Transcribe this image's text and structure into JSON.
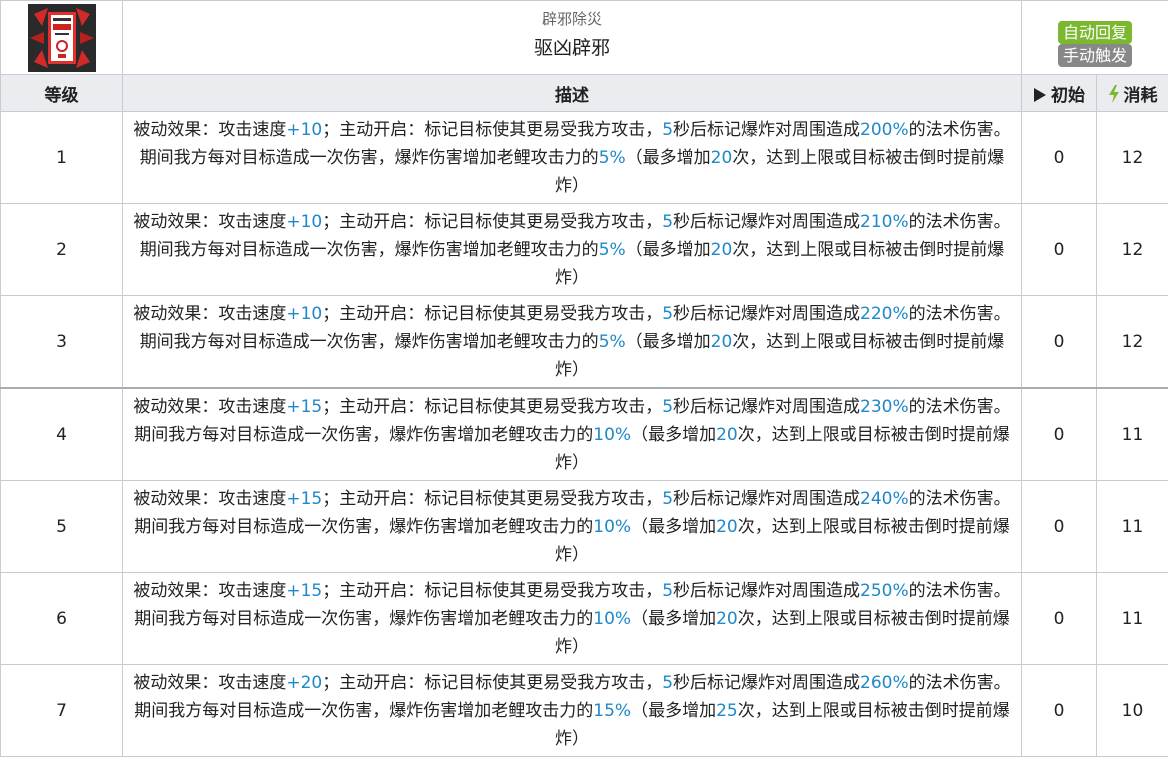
{
  "skill": {
    "subtitle": "辟邪除災",
    "name": "驱凶辟邪",
    "icon": "skill-red-seal-icon",
    "tags": {
      "auto": "自动回复",
      "manual": "手动触发"
    }
  },
  "table": {
    "headers": {
      "level": "等级",
      "desc": "描述",
      "initial": "初始",
      "cost": "消耗"
    },
    "rows": [
      {
        "level": "1",
        "speed": "+10",
        "seconds": "5",
        "damage": "200%",
        "atk": "5%",
        "max": "20",
        "initial": "0",
        "cost": "12"
      },
      {
        "level": "2",
        "speed": "+10",
        "seconds": "5",
        "damage": "210%",
        "atk": "5%",
        "max": "20",
        "initial": "0",
        "cost": "12"
      },
      {
        "level": "3",
        "speed": "+10",
        "seconds": "5",
        "damage": "220%",
        "atk": "5%",
        "max": "20",
        "initial": "0",
        "cost": "12"
      },
      {
        "level": "4",
        "speed": "+15",
        "seconds": "5",
        "damage": "230%",
        "atk": "10%",
        "max": "20",
        "initial": "0",
        "cost": "11"
      },
      {
        "level": "5",
        "speed": "+15",
        "seconds": "5",
        "damage": "240%",
        "atk": "10%",
        "max": "20",
        "initial": "0",
        "cost": "11"
      },
      {
        "level": "6",
        "speed": "+15",
        "seconds": "5",
        "damage": "250%",
        "atk": "10%",
        "max": "20",
        "initial": "0",
        "cost": "11"
      },
      {
        "level": "7",
        "speed": "+20",
        "seconds": "5",
        "damage": "260%",
        "atk": "15%",
        "max": "25",
        "initial": "0",
        "cost": "10"
      }
    ]
  },
  "desc_text": {
    "p1": "被动效果：攻击速度",
    "p2": "；主动开启：标记目标使其更易受我方攻击，",
    "p3": "秒后标记爆炸对周围造成",
    "p4": "的法术伤害。期间我方每对目标造成一次伤害，爆炸伤害增加老鲤攻击力的",
    "p5": "（最多增加",
    "p6": "次，达到上限或目标被击倒时提前爆炸）"
  },
  "colors": {
    "highlight": "#1e88c8",
    "tag_auto": "#7cb82f",
    "tag_manual": "#888888",
    "header_bg": "#eaecf0"
  }
}
